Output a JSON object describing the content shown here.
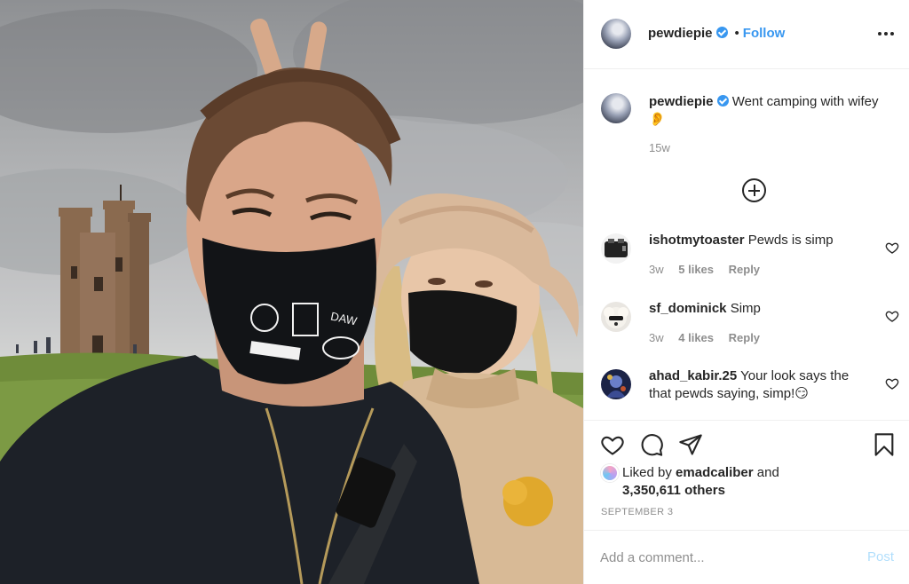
{
  "post": {
    "author": "pewdiepie",
    "verified": true,
    "follow_label": "Follow",
    "separator": "•",
    "caption": "Went camping with wifey 👂",
    "caption_age": "15w"
  },
  "comments": [
    {
      "username": "ishotmytoaster",
      "text": "Pewds is simp",
      "age": "3w",
      "likes": "5 likes",
      "reply_label": "Reply",
      "avatar": "toaster-avatar"
    },
    {
      "username": "sf_dominick",
      "text": "Simp",
      "age": "3w",
      "likes": "4 likes",
      "reply_label": "Reply",
      "avatar": "dog-avatar"
    },
    {
      "username": "ahad_kabir.25",
      "text": "Your look says the that pewds saying, simp!😏",
      "avatar": "character-avatar"
    }
  ],
  "likes": {
    "prefix": "Liked by",
    "liker": "emadcaliber",
    "conjunction": "and",
    "others": "3,350,611 others"
  },
  "date": "SEPTEMBER 3",
  "comment_box": {
    "placeholder": "Add a comment...",
    "post_label": "Post"
  },
  "icons": [
    "heart-icon",
    "comment-icon",
    "share-icon",
    "bookmark-icon",
    "more-options-icon",
    "load-more-icon",
    "verified-badge-icon"
  ],
  "colors": {
    "link_blue": "#3897f0",
    "post_disabled": "#b2dffc",
    "secondary_text": "#8e8e8e"
  }
}
